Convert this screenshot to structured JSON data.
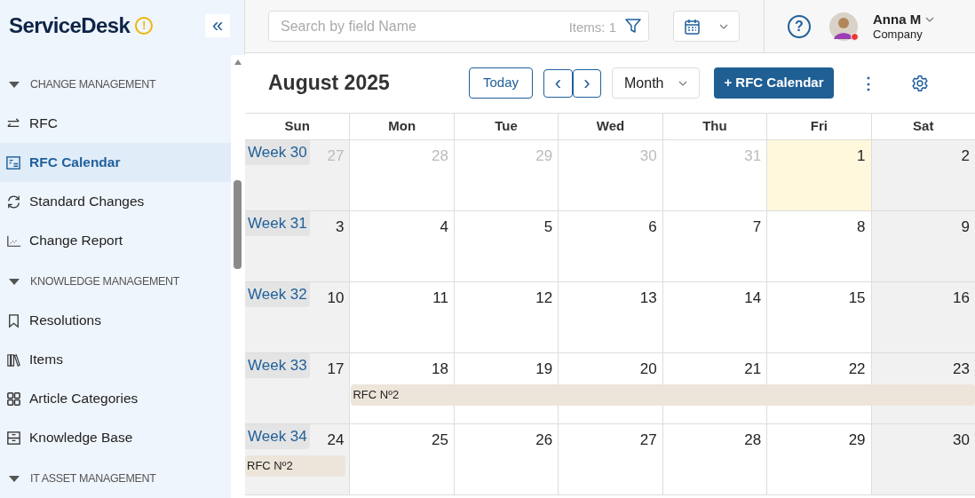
{
  "app": {
    "title": "ServiceDesk",
    "warning": "!",
    "collapse": "«"
  },
  "sidebar": {
    "sections": [
      {
        "label": "CHANGE MANAGEMENT",
        "expanded": true,
        "items": [
          {
            "label": "RFC",
            "selected": false
          },
          {
            "label": "RFC Calendar",
            "selected": true
          },
          {
            "label": "Standard Changes",
            "selected": false
          },
          {
            "label": "Change Report",
            "selected": false
          }
        ]
      },
      {
        "label": "KNOWLEDGE MANAGEMENT",
        "expanded": true,
        "items": [
          {
            "label": "Resolutions",
            "selected": false
          },
          {
            "label": "Items",
            "selected": false
          },
          {
            "label": "Article Categories",
            "selected": false
          },
          {
            "label": "Knowledge Base",
            "selected": false
          }
        ]
      },
      {
        "label": "IT ASSET MANAGEMENT",
        "expanded": true
      }
    ]
  },
  "search": {
    "placeholder": "Search by field Name",
    "count": "Items: 1"
  },
  "user": {
    "name": "Anna M",
    "company": "Company"
  },
  "help": "?",
  "toolbar": {
    "title": "August 2025",
    "today": "Today",
    "prev": "‹",
    "next": "›",
    "view": "Month",
    "add": "+ RFC Calendar",
    "more": "⋮"
  },
  "weekdays": [
    "Sun",
    "Mon",
    "Tue",
    "Wed",
    "Thu",
    "Fri",
    "Sat"
  ],
  "weeks": [
    {
      "label": "Week 30",
      "days": [
        {
          "n": "27",
          "muted": true
        },
        {
          "n": "28",
          "muted": true
        },
        {
          "n": "29",
          "muted": true
        },
        {
          "n": "30",
          "muted": true
        },
        {
          "n": "31",
          "muted": true
        },
        {
          "n": "1",
          "today": true
        },
        {
          "n": "2"
        }
      ]
    },
    {
      "label": "Week 31",
      "days": [
        {
          "n": "3"
        },
        {
          "n": "4"
        },
        {
          "n": "5"
        },
        {
          "n": "6"
        },
        {
          "n": "7"
        },
        {
          "n": "8"
        },
        {
          "n": "9"
        }
      ]
    },
    {
      "label": "Week 32",
      "days": [
        {
          "n": "10"
        },
        {
          "n": "11"
        },
        {
          "n": "12"
        },
        {
          "n": "13"
        },
        {
          "n": "14"
        },
        {
          "n": "15"
        },
        {
          "n": "16"
        }
      ]
    },
    {
      "label": "Week 33",
      "days": [
        {
          "n": "17"
        },
        {
          "n": "18",
          "event": "RFC Nº2"
        },
        {
          "n": "19",
          "in_event": true
        },
        {
          "n": "20",
          "in_event": true
        },
        {
          "n": "21",
          "in_event": true
        },
        {
          "n": "22",
          "in_event": true
        },
        {
          "n": "23",
          "in_event": true
        }
      ]
    },
    {
      "label": "Week 34",
      "days": [
        {
          "n": "24",
          "event": "RFC Nº2"
        },
        {
          "n": "25"
        },
        {
          "n": "26"
        },
        {
          "n": "27"
        },
        {
          "n": "28"
        },
        {
          "n": "29"
        },
        {
          "n": "30"
        }
      ]
    }
  ]
}
